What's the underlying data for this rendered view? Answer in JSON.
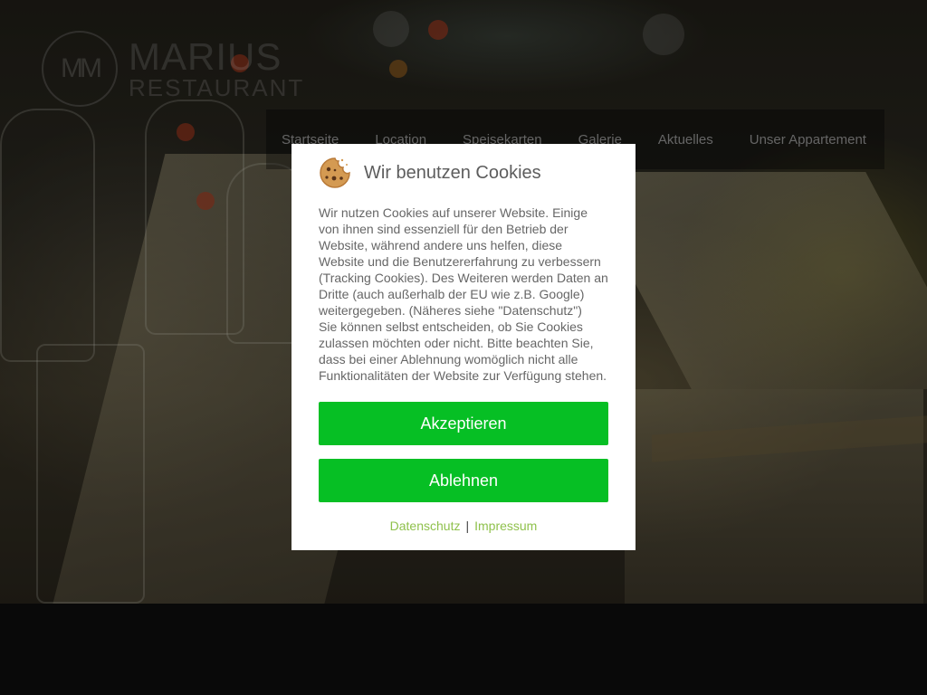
{
  "brand": {
    "monogram": "MM",
    "name": "MARIUS",
    "subtitle": "RESTAURANT"
  },
  "nav": {
    "items": [
      "Startseite",
      "Location",
      "Speisekarten",
      "Galerie",
      "Aktuelles",
      "Unser Appartement"
    ]
  },
  "cookie_dialog": {
    "icon": "cookie-icon",
    "title": "Wir benutzen Cookies",
    "text_paragraph1": "Wir nutzen Cookies auf unserer Website. Einige von ihnen sind essenziell für den Betrieb der Website, während andere uns helfen, diese Website und die Benutzererfahrung zu verbessern (Tracking Cookies). Des Weiteren werden Daten an Dritte (auch außerhalb der EU wie z.B. Google) weitergegeben. (Näheres siehe \"Datenschutz\")",
    "text_paragraph2": "Sie können selbst entscheiden, ob Sie Cookies zulassen möchten oder nicht. Bitte beachten Sie, dass bei einer Ablehnung womöglich nicht alle Funktionalitäten der Website zur Verfügung stehen.",
    "accept_label": "Akzeptieren",
    "reject_label": "Ablehnen",
    "privacy_link": "Datenschutz",
    "separator": "|",
    "imprint_link": "Impressum"
  },
  "colors": {
    "button": "#06bf24",
    "link": "#8fc14c",
    "footer_bg": "#0f0f0f"
  }
}
